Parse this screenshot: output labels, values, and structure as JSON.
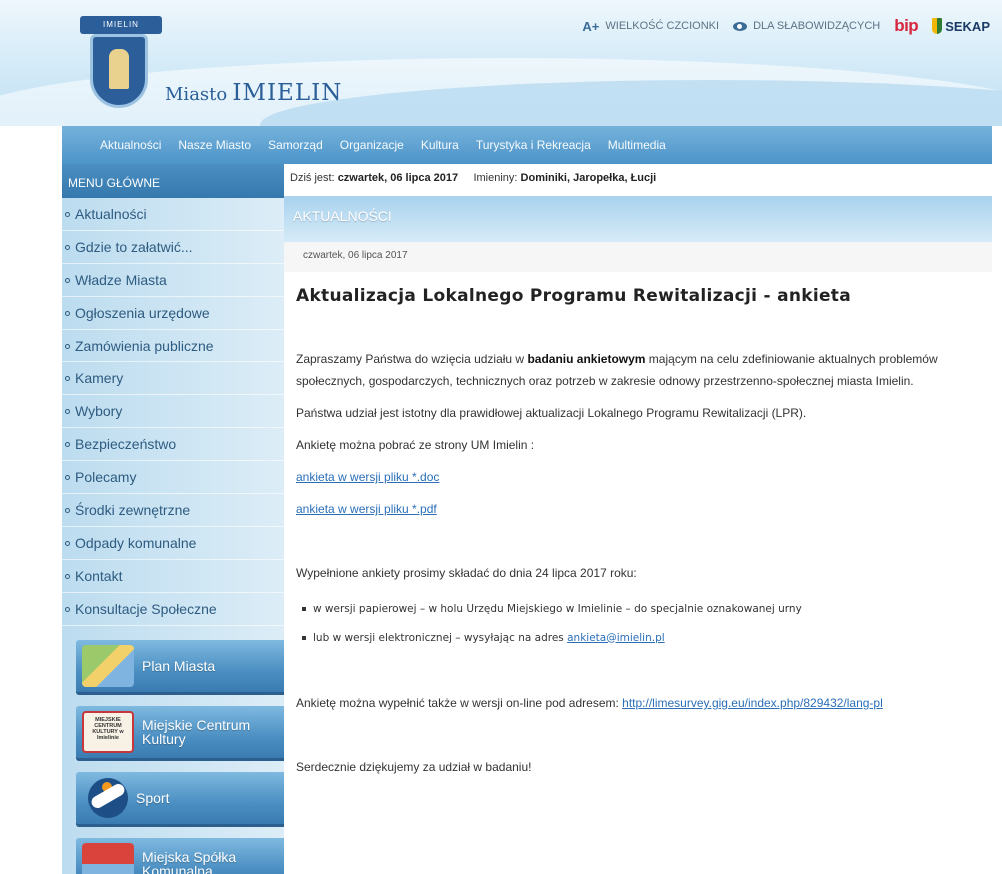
{
  "header": {
    "crest_banner": "IMIELIN",
    "brand_prefix": "Miasto",
    "brand_name": "IMIELIN",
    "top_links": {
      "font_size_icon": "A+",
      "font_size_label": "WIELKOŚĆ CZCIONKI",
      "accessibility_label": "DLA SŁABOWIDZĄCYCH",
      "bip_label": "bip",
      "sekap_label": "SEKAP"
    }
  },
  "nav": {
    "items": [
      "Aktualności",
      "Nasze Miasto",
      "Samorząd",
      "Organizacje",
      "Kultura",
      "Turystyka i Rekreacja",
      "Multimedia"
    ]
  },
  "sidebar": {
    "menu_title": "MENU GŁÓWNE",
    "items": [
      "Aktualności",
      "Gdzie to załatwić...",
      "Władze Miasta",
      "Ogłoszenia urzędowe",
      "Zamówienia publiczne",
      "Kamery",
      "Wybory",
      "Bezpieczeństwo",
      "Polecamy",
      "Środki zewnętrzne",
      "Odpady komunalne",
      "Kontakt",
      "Konsultacje Społeczne"
    ],
    "banners": {
      "map": "Plan Miasta",
      "culture_line1": "Miejskie Centrum",
      "culture_line2": "Kultury",
      "culture_logo": "MIEJSKIE CENTRUM KULTURY w Imielinie",
      "sport": "Sport",
      "utility_line1": "Miejska Spółka",
      "utility_line2": "Komunalna"
    }
  },
  "datebar": {
    "today_label": "Dziś jest:",
    "today_value": "czwartek, 06 lipca 2017",
    "names_label": "Imieniny:",
    "names_value": "Dominiki, Jaropełka, Łucji"
  },
  "section": {
    "heading": "AKTUALNOŚCI",
    "date": "czwartek, 06 lipca 2017"
  },
  "article": {
    "title": "Aktualizacja Lokalnego Programu Rewitalizacji - ankieta",
    "p1_before": "Zapraszamy Państwa do wzięcia udziału w ",
    "p1_bold": "badaniu ankietowym",
    "p1_after": " mającym na celu zdefiniowanie aktualnych problemów społecznych, gospodarczych, technicznych oraz potrzeb w zakresie odnowy przestrzenno-społecznej miasta Imielin.",
    "p2": "Państwa udział jest istotny dla prawidłowej aktualizacji Lokalnego Programu Rewitalizacji (LPR).",
    "p3": "Ankietę można pobrać ze strony UM Imielin :",
    "link_doc": "ankieta w wersji pliku *.doc",
    "link_pdf": "ankieta w wersji pliku *.pdf",
    "p4": "Wypełnione ankiety prosimy składać do dnia 24 lipca 2017 roku:",
    "bullet1": "w wersji papierowej – w holu Urzędu Miejskiego w Imielinie – do specjalnie oznakowanej urny",
    "bullet2_text": "lub w wersji elektronicznej – wysyłając na adres ",
    "bullet2_email": "ankieta@imielin.pl",
    "p5_text": "Ankietę można wypełnić także w wersji on-line pod adresem: ",
    "p5_link": "http://limesurvey.gig.eu/index.php/829432/lang-pl",
    "p6": "Serdecznie dziękujemy za udział w badaniu!"
  },
  "colors": {
    "nav_bg": "#4d94c8",
    "menu_head_bg": "#3478ad",
    "sidebar_bg": "#dcedf7",
    "link": "#2a6fb8",
    "bip_red": "#d7263d"
  }
}
